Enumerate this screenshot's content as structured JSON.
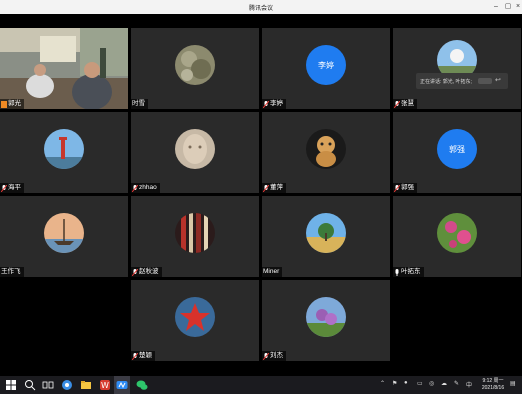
{
  "window": {
    "title": "腾讯会议"
  },
  "participants": [
    {
      "name": "郭光",
      "mic": "active-orange",
      "type": "video"
    },
    {
      "name": "时雪",
      "mic": "none",
      "type": "photo"
    },
    {
      "name": "李婷",
      "mic": "muted",
      "type": "text-avatar",
      "avatar_text": "李婷"
    },
    {
      "name": "张慧",
      "mic": "muted",
      "type": "photo"
    },
    {
      "name": "海平",
      "mic": "muted",
      "type": "photo"
    },
    {
      "name": "zhhao",
      "mic": "muted",
      "type": "photo"
    },
    {
      "name": "董萍",
      "mic": "muted",
      "type": "photo"
    },
    {
      "name": "郭强",
      "mic": "muted",
      "type": "text-avatar",
      "avatar_text": "郭强"
    },
    {
      "name": "王作飞",
      "mic": "none",
      "type": "photo"
    },
    {
      "name": "赵秋波",
      "mic": "muted",
      "type": "photo"
    },
    {
      "name": "Miner",
      "mic": "none",
      "type": "photo"
    },
    {
      "name": "叶拓东",
      "mic": "on",
      "type": "photo"
    },
    {
      "name": "楚颖",
      "mic": "muted",
      "type": "photo"
    },
    {
      "name": "刘杰",
      "mic": "muted",
      "type": "photo"
    }
  ],
  "speaking_popup": {
    "label": "正在讲话: 郭光, 叶拓东;"
  },
  "taskbar": {
    "tray_lang": "中",
    "clock_time": "9:12 周一",
    "clock_date": "2021/8/16"
  },
  "colors": {
    "tile_bg": "#2a2a2a",
    "avatar_blue": "#1f7cf0",
    "taskbar_bg": "#1b1b1f"
  }
}
